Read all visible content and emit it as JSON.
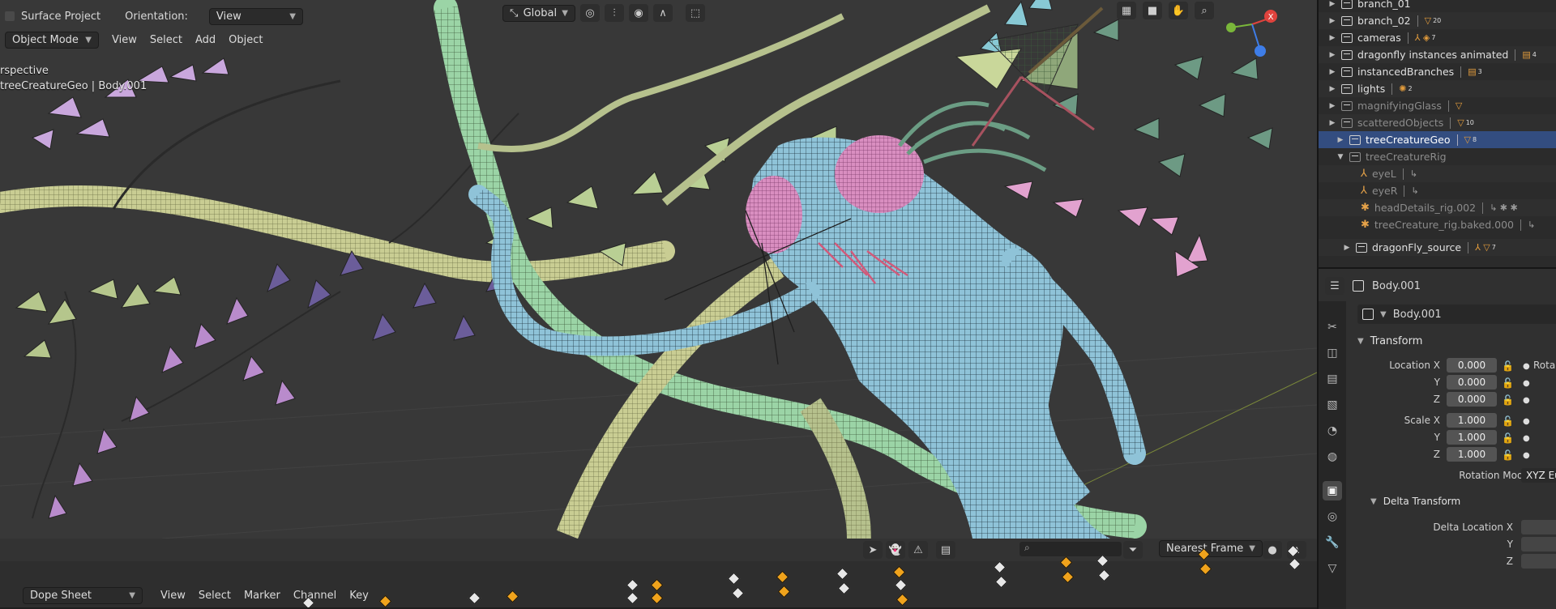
{
  "viewport": {
    "tool_label": "Surface Project",
    "orientation_label": "Orientation:",
    "orientation_value": "View",
    "mode": "Object Mode",
    "menu": [
      "View",
      "Select",
      "Add",
      "Object"
    ],
    "transform_orientation": "Global",
    "view_name": "rspective",
    "object_info": "treeCreatureGeo | Body.001"
  },
  "outliner": {
    "rows": [
      {
        "label": "branch_01",
        "badge": ""
      },
      {
        "label": "branch_02",
        "badge": "20"
      },
      {
        "label": "cameras",
        "badge": "7"
      },
      {
        "label": "dragonfly instances animated",
        "badge": "4"
      },
      {
        "label": "instancedBranches",
        "badge": "3"
      },
      {
        "label": "lights",
        "badge": "2"
      },
      {
        "label": "magnifyingGlass",
        "badge": ""
      },
      {
        "label": "scatteredObjects",
        "badge": "10"
      },
      {
        "label": "treeCreatureGeo",
        "badge": "8"
      },
      {
        "label": "treeCreatureRig",
        "badge": ""
      },
      {
        "label": "eyeL",
        "badge": ""
      },
      {
        "label": "eyeR",
        "badge": ""
      },
      {
        "label": "headDetails_rig.002",
        "badge": ""
      },
      {
        "label": "treeCreature_rig.baked.000",
        "badge": ""
      },
      {
        "label": "dragonFly_source",
        "badge": "7"
      }
    ]
  },
  "properties": {
    "header_object": "Body.001",
    "object_name": "Body.001",
    "transform_title": "Transform",
    "location_label": "Location X",
    "rotation_label": "Rota",
    "axis_y": "Y",
    "axis_z": "Z",
    "location": [
      "0.000",
      "0.000",
      "0.000"
    ],
    "scale_label": "Scale X",
    "scale": [
      "1.000",
      "1.000",
      "1.000"
    ],
    "rotation_mode_label": "Rotation Mode",
    "rotation_mode_value": "XYZ Eu",
    "delta_title": "Delta Transform",
    "delta_location_label": "Delta Location X"
  },
  "dopesheet": {
    "editor": "Dope Sheet",
    "menu": [
      "View",
      "Select",
      "Marker",
      "Channel",
      "Key"
    ],
    "snap_mode": "Nearest Frame"
  },
  "colors": {
    "selection": "#334d80",
    "keyframe_selected": "#f0a31c",
    "keyframe": "#e8e8e8",
    "creature_mesh": "#8fc3d8",
    "eyes": "#d98ec0",
    "branches": "#c8cf8f"
  }
}
